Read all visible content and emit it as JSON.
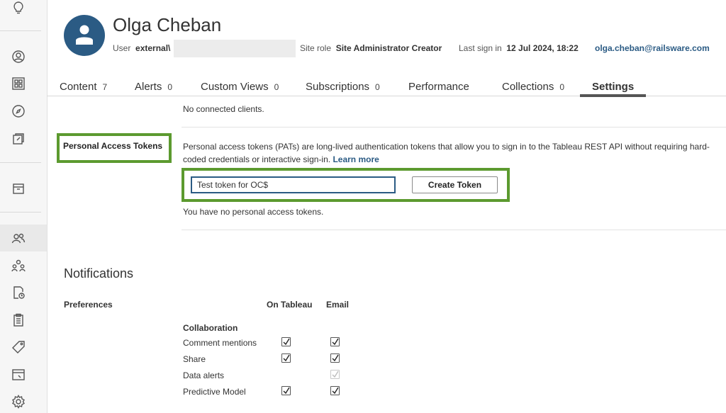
{
  "user": {
    "name": "Olga Cheban",
    "user_label": "User",
    "username_prefix": "external\\",
    "site_role_label": "Site role",
    "site_role": "Site Administrator Creator",
    "last_sign_in_label": "Last sign in",
    "last_sign_in": "12 Jul 2024, 18:22",
    "email": "olga.cheban@railsware.com"
  },
  "tabs": [
    {
      "label": "Content",
      "count": "7"
    },
    {
      "label": "Alerts",
      "count": "0"
    },
    {
      "label": "Custom Views",
      "count": "0"
    },
    {
      "label": "Subscriptions",
      "count": "0"
    },
    {
      "label": "Performance",
      "count": ""
    },
    {
      "label": "Collections",
      "count": "0"
    },
    {
      "label": "Settings",
      "count": ""
    }
  ],
  "active_tab": "Settings",
  "settings": {
    "connected_clients_text": "No connected clients.",
    "pat": {
      "label": "Personal Access Tokens",
      "description": "Personal access tokens (PATs) are long-lived authentication tokens that allow you to sign in to the Tableau REST API without requiring hard-coded credentials or interactive sign-in.",
      "learn_more": "Learn more",
      "token_name_value": "Test token for OC$",
      "create_button": "Create Token",
      "empty_text": "You have no personal access tokens."
    },
    "notifications": {
      "title": "Notifications",
      "preferences_label": "Preferences",
      "col_on_tableau": "On Tableau",
      "col_email": "Email",
      "group_label": "Collaboration",
      "rows": [
        {
          "label": "Comment mentions",
          "on_tableau": true,
          "email": true
        },
        {
          "label": "Share",
          "on_tableau": true,
          "email": true
        },
        {
          "label": "Data alerts",
          "on_tableau": null,
          "email": "disabled-checked"
        },
        {
          "label": "Predictive Model",
          "on_tableau": true,
          "email": true
        }
      ]
    }
  },
  "sidebar_icons": [
    "lightbulb-icon",
    "user-circle-icon",
    "grid-icon",
    "compass-icon",
    "external-link-icon",
    "archive-icon",
    "users-icon",
    "groups-icon",
    "schedule-icon",
    "clipboard-icon",
    "tag-icon",
    "web-window-icon",
    "gear-icon"
  ],
  "colors": {
    "accent": "#2b5b84",
    "highlight": "#5c9a2f"
  }
}
